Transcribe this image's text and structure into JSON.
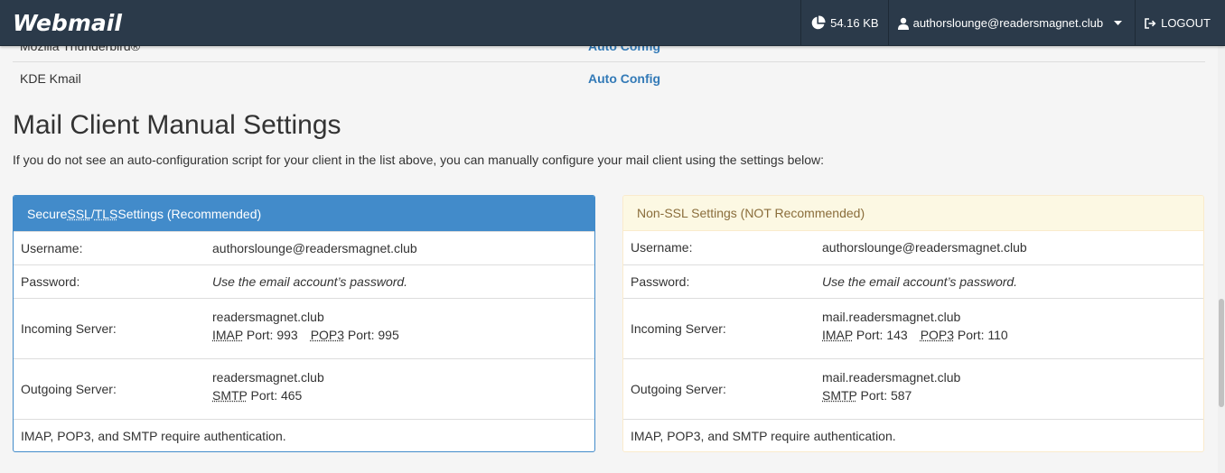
{
  "navbar": {
    "logo": "Webmail",
    "disk_usage": "54.16 KB",
    "user_email": "authorslounge@readersmagnet.club",
    "logout_label": "LOGOUT"
  },
  "clients": [
    {
      "name": "Mozilla Thunderbird®",
      "link": "Auto Config"
    },
    {
      "name": "KDE Kmail",
      "link": "Auto Config"
    }
  ],
  "manual": {
    "title": "Mail Client Manual Settings",
    "description": "If you do not see an auto-configuration script for your client in the list above, you can manually configure your mail client using the settings below:"
  },
  "ssl": {
    "heading_pre": "Secure ",
    "heading_ssl": "SSL",
    "heading_slash": "/",
    "heading_tls": "TLS",
    "heading_post": " Settings (Recommended)",
    "username_label": "Username:",
    "username": "authorslounge@readersmagnet.club",
    "password_label": "Password:",
    "password": "Use the email account’s password.",
    "incoming_label": "Incoming Server:",
    "incoming_host": "readersmagnet.club",
    "imap_abbr": "IMAP",
    "imap_port": " Port: 993",
    "pop3_abbr": "POP3",
    "pop3_port": " Port: 995",
    "outgoing_label": "Outgoing Server:",
    "outgoing_host": "readersmagnet.club",
    "smtp_abbr": "SMTP",
    "smtp_port": " Port: 465",
    "note": "IMAP, POP3, and SMTP require authentication."
  },
  "nonssl": {
    "heading": "Non-SSL Settings (NOT Recommended)",
    "username_label": "Username:",
    "username": "authorslounge@readersmagnet.club",
    "password_label": "Password:",
    "password": "Use the email account’s password.",
    "incoming_label": "Incoming Server:",
    "incoming_host": "mail.readersmagnet.club",
    "imap_abbr": "IMAP",
    "imap_port": " Port: 143",
    "pop3_abbr": "POP3",
    "pop3_port": " Port: 110",
    "outgoing_label": "Outgoing Server:",
    "outgoing_host": "mail.readersmagnet.club",
    "smtp_abbr": "SMTP",
    "smtp_port": " Port: 587",
    "note": "IMAP, POP3, and SMTP require authentication."
  },
  "colors": {
    "navbar_bg": "#2b3a4a",
    "primary": "#428bca",
    "link": "#337ab7",
    "warning_bg": "#fcf8e3",
    "warning_text": "#8a6d3b"
  }
}
